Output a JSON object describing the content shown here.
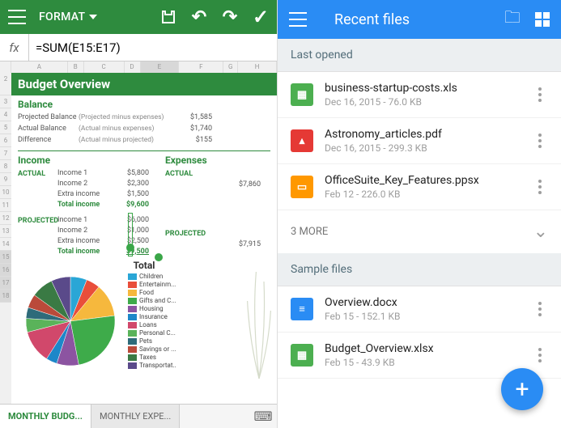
{
  "left": {
    "toolbar": {
      "format_label": "FORMAT"
    },
    "formula": {
      "fx": "fx",
      "value": "=SUM(E15:E17)"
    },
    "columns": [
      "A",
      "B",
      "C",
      "D",
      "E",
      "F",
      "G",
      "H"
    ],
    "rows_visible": [
      "2",
      "3",
      "4",
      "5",
      "6",
      "7",
      "8",
      "9",
      "10",
      "11",
      "12",
      "13",
      "14",
      "15",
      "16",
      "17",
      "18"
    ],
    "title": "Budget Overview",
    "balance": {
      "header": "Balance",
      "rows": [
        {
          "label": "Projected Balance",
          "sub": "(Projected  minus expenses)",
          "val": "$1,585"
        },
        {
          "label": "Actual Balance",
          "sub": "(Actual  minus expenses)",
          "val": "$1,740"
        },
        {
          "label": "Difference",
          "sub": "(Actual minus projected)",
          "val": "$155"
        }
      ]
    },
    "income": {
      "header": "Income",
      "actual_label": "ACTUAL",
      "projected_label": "PROJECTED",
      "actual_rows": [
        {
          "label": "Income 1",
          "val": "$5,800"
        },
        {
          "label": "Income 2",
          "val": "$2,300"
        },
        {
          "label": "Extra income",
          "val": "$1,500"
        },
        {
          "label": "Total income",
          "val": "$9,600"
        }
      ],
      "projected_rows": [
        {
          "label": "Income 1",
          "val": "$6,000"
        },
        {
          "label": "Income 2",
          "val": "$1,000"
        },
        {
          "label": "Extra income",
          "val": "$2,500"
        },
        {
          "label": "Total income",
          "val": "$9,500"
        }
      ]
    },
    "expenses": {
      "header": "Expenses",
      "actual_label": "ACTUAL",
      "projected_label": "PROJECTED",
      "actual_val": "$7,860",
      "projected_val": "$7,915"
    },
    "chart": {
      "title": "Total"
    },
    "legend": [
      {
        "label": "Children",
        "color": "#2aa6d6"
      },
      {
        "label": "Entertainm...",
        "color": "#e94e3a"
      },
      {
        "label": "Food",
        "color": "#f6b83d"
      },
      {
        "label": "Gifts and C...",
        "color": "#3eab4a"
      },
      {
        "label": "Housing",
        "color": "#8c54a1"
      },
      {
        "label": "Insurance",
        "color": "#1d87c9"
      },
      {
        "label": "Loans",
        "color": "#d1486b"
      },
      {
        "label": "Personal C...",
        "color": "#5ab35a"
      },
      {
        "label": "Pets",
        "color": "#2e6b7a"
      },
      {
        "label": "Savings or ...",
        "color": "#ba4a3a"
      },
      {
        "label": "Taxes",
        "color": "#3a7a44"
      },
      {
        "label": "Transportat..",
        "color": "#5a4a8a"
      }
    ],
    "tabs": {
      "active": "MONTHLY BUDG...",
      "other": "MONTHLY EXPE..."
    }
  },
  "right": {
    "title": "Recent files",
    "sections": {
      "last_opened": "Last opened",
      "sample": "Sample files",
      "more": "3 MORE"
    },
    "files_last": [
      {
        "name": "business-startup-costs.xls",
        "meta": "Dec 16, 2015 - 76.0 KB",
        "type": "xls"
      },
      {
        "name": "Astronomy_articles.pdf",
        "meta": "Dec 16, 2015 - 299.3 KB",
        "type": "pdf"
      },
      {
        "name": "OfficeSuite_Key_Features.ppsx",
        "meta": "Feb 12 - 226.0 KB",
        "type": "ppt"
      }
    ],
    "files_sample": [
      {
        "name": "Overview.docx",
        "meta": "Feb 15 - 152.1 KB",
        "type": "doc"
      },
      {
        "name": "Budget_Overview.xlsx",
        "meta": "Feb 15 - 43.9 KB",
        "type": "xls"
      }
    ]
  },
  "chart_data": {
    "type": "pie",
    "title": "Total",
    "series": [
      {
        "name": "Children",
        "value": 6,
        "color": "#2aa6d6"
      },
      {
        "name": "Entertainment",
        "value": 5,
        "color": "#e94e3a"
      },
      {
        "name": "Food",
        "value": 12,
        "color": "#f6b83d"
      },
      {
        "name": "Gifts and Charity",
        "value": 24,
        "color": "#3eab4a"
      },
      {
        "name": "Housing",
        "value": 8,
        "color": "#8c54a1"
      },
      {
        "name": "Insurance",
        "value": 4,
        "color": "#1d87c9"
      },
      {
        "name": "Loans",
        "value": 12,
        "color": "#d1486b"
      },
      {
        "name": "Personal Care",
        "value": 5,
        "color": "#5ab35a"
      },
      {
        "name": "Pets",
        "value": 4,
        "color": "#2e6b7a"
      },
      {
        "name": "Savings or Investments",
        "value": 5,
        "color": "#ba4a3a"
      },
      {
        "name": "Taxes",
        "value": 8,
        "color": "#3a7a44"
      },
      {
        "name": "Transportation",
        "value": 7,
        "color": "#5a4a8a"
      }
    ]
  }
}
